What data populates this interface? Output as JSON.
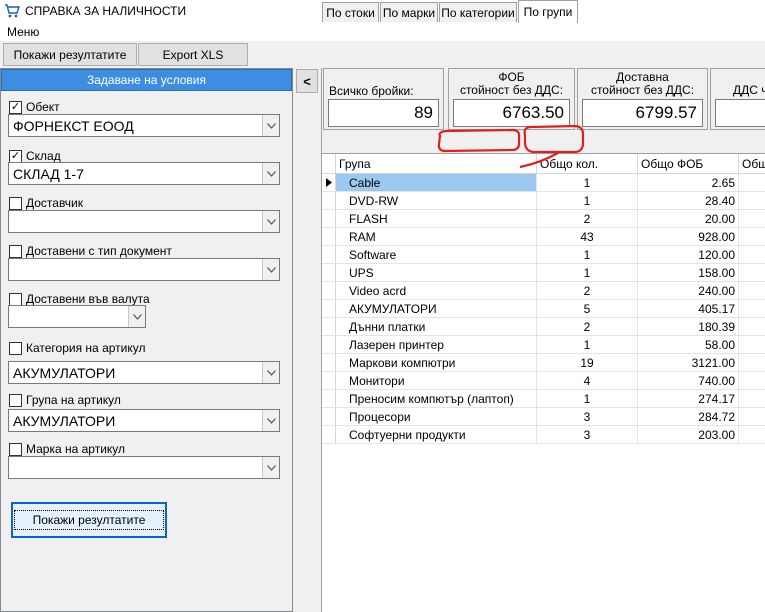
{
  "window": {
    "title": "СПРАВКА ЗА НАЛИЧНОСТИ",
    "icon": "cart-icon"
  },
  "menu": {
    "items": [
      "Меню"
    ]
  },
  "toolbar": {
    "show_results_label": "Покажи резултатите",
    "export_label": "Export XLS"
  },
  "conditions": {
    "header": "Задаване на условия",
    "object": {
      "label": "Обект",
      "checked": true,
      "value": "ФОРНЕКСТ ЕООД"
    },
    "warehouse": {
      "label": "Склад",
      "checked": true,
      "value": "СКЛАД 1-7"
    },
    "supplier": {
      "label": "Доставчик",
      "checked": false,
      "value": ""
    },
    "doc_type": {
      "label": "Доставени с тип документ",
      "checked": false,
      "value": ""
    },
    "currency": {
      "label": "Доставени във валута",
      "checked": false,
      "value": ""
    },
    "category": {
      "label": "Категория на артикул",
      "checked": false,
      "value": "АКУМУЛАТОРИ"
    },
    "group": {
      "label": "Група на артикул",
      "checked": false,
      "value": "АКУМУЛАТОРИ"
    },
    "brand": {
      "label": "Марка на артикул",
      "checked": false,
      "value": ""
    },
    "show_button": "Покажи резултатите"
  },
  "collapse_button": "<",
  "summary": {
    "total_qty": {
      "label": "Всичко бройки:",
      "value": "89"
    },
    "fob": {
      "label_line1": "ФОБ",
      "label_line2": "стойност без ДДС:",
      "value": "6763.50"
    },
    "delivery": {
      "label_line1": "Доставна",
      "label_line2": "стойност без ДДС:",
      "value": "6799.57"
    },
    "vat": {
      "label": "ДДС ч"
    }
  },
  "tabs": [
    "По стоки",
    "По марки",
    "По категории",
    "По групи"
  ],
  "active_tab": "По групи",
  "grid": {
    "columns": [
      "Група",
      "Общо кол.",
      "Общо ФОБ",
      "Общ"
    ],
    "rows": [
      [
        "Cable",
        "1",
        "2.65"
      ],
      [
        "DVD-RW",
        "1",
        "28.40"
      ],
      [
        "FLASH",
        "2",
        "20.00"
      ],
      [
        "RAM",
        "43",
        "928.00"
      ],
      [
        "Software",
        "1",
        "120.00"
      ],
      [
        "UPS",
        "1",
        "158.00"
      ],
      [
        "Video acrd",
        "2",
        "240.00"
      ],
      [
        "АКУМУЛАТОРИ",
        "5",
        "405.17"
      ],
      [
        "Дънни платки",
        "2",
        "180.39"
      ],
      [
        "Лазерен принтер",
        "1",
        "58.00"
      ],
      [
        "Маркови компютри",
        "19",
        "3121.00"
      ],
      [
        "Монитори",
        "4",
        "740.00"
      ],
      [
        "Преносим компютър (лаптоп)",
        "1",
        "274.17"
      ],
      [
        "Процесори",
        "3",
        "284.72"
      ],
      [
        "Софтуерни продукти",
        "3",
        "203.00"
      ]
    ]
  },
  "colors": {
    "accent": "#3d8ee0",
    "selection": "#99c9ef",
    "annotation": "#e02020"
  }
}
